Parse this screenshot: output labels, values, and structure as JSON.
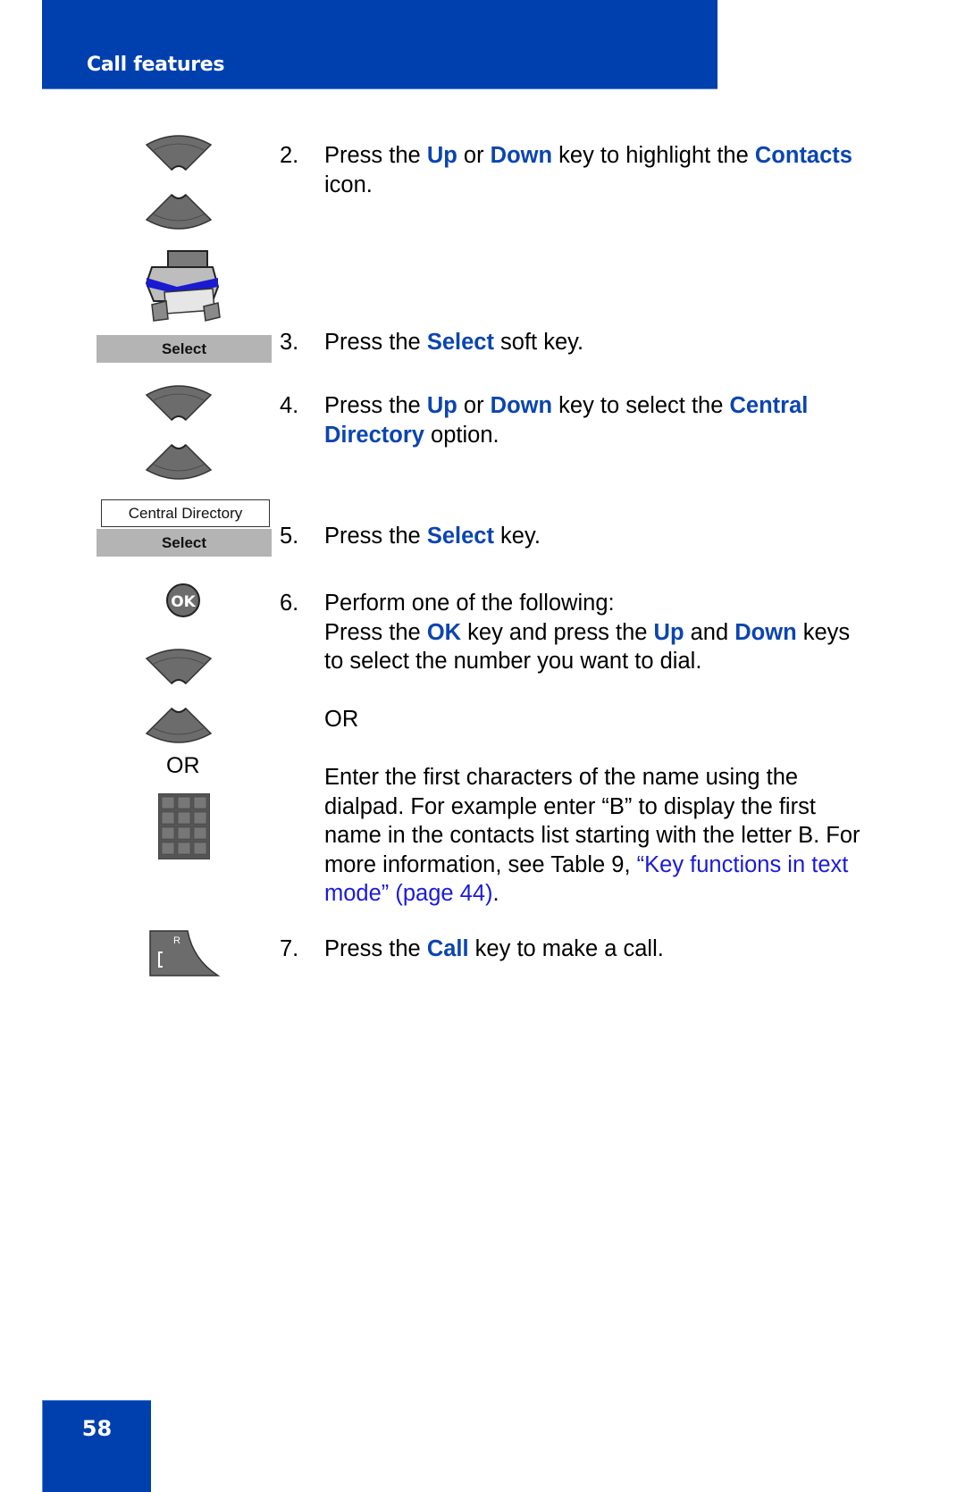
{
  "header": {
    "section_title": "Call features",
    "brand_color": "#003fae"
  },
  "footer": {
    "page_number": "58"
  },
  "left_column": {
    "icons": {
      "up_key": "up-navigation-key-icon",
      "down_key": "down-navigation-key-icon",
      "contacts": "contacts-icon",
      "ok_key": "ok-key-icon",
      "dialpad": "dialpad-icon",
      "call_key": "call-key-icon"
    },
    "ok_glyph": "OK",
    "call_key_glyph": "R",
    "softkey_select_1": "Select",
    "display_option": "Central Directory",
    "softkey_select_2": "Select",
    "or_label": "OR"
  },
  "steps": [
    {
      "number": "2.",
      "parts": [
        "Press the ",
        "Up",
        " or ",
        "Down",
        " key to highlight the ",
        "Contacts",
        " icon."
      ]
    },
    {
      "number": "3.",
      "parts": [
        "Press the ",
        "Select",
        " soft key."
      ]
    },
    {
      "number": "4.",
      "parts": [
        "Press the ",
        "Up",
        " or ",
        "Down",
        " key to select the ",
        "Central Directory",
        " option."
      ]
    },
    {
      "number": "5.",
      "parts": [
        "Press the ",
        "Select",
        " key."
      ]
    },
    {
      "number": "6.",
      "intro": "Perform one of the following:",
      "option_a": [
        "Press the ",
        "OK",
        " key and press the ",
        "Up",
        " and ",
        "Down",
        " keys to select the number you want to dial."
      ],
      "or": "OR",
      "option_b_text": "Enter the first characters of the name using the dialpad. For example enter “B” to display the first name in the contacts list starting with the letter B. For more information, see Table 9, ",
      "option_b_link": "“Key functions in text mode” (page 44)",
      "option_b_end": "."
    },
    {
      "number": "7.",
      "parts": [
        "Press the ",
        "Call",
        " key to make a call."
      ]
    }
  ]
}
